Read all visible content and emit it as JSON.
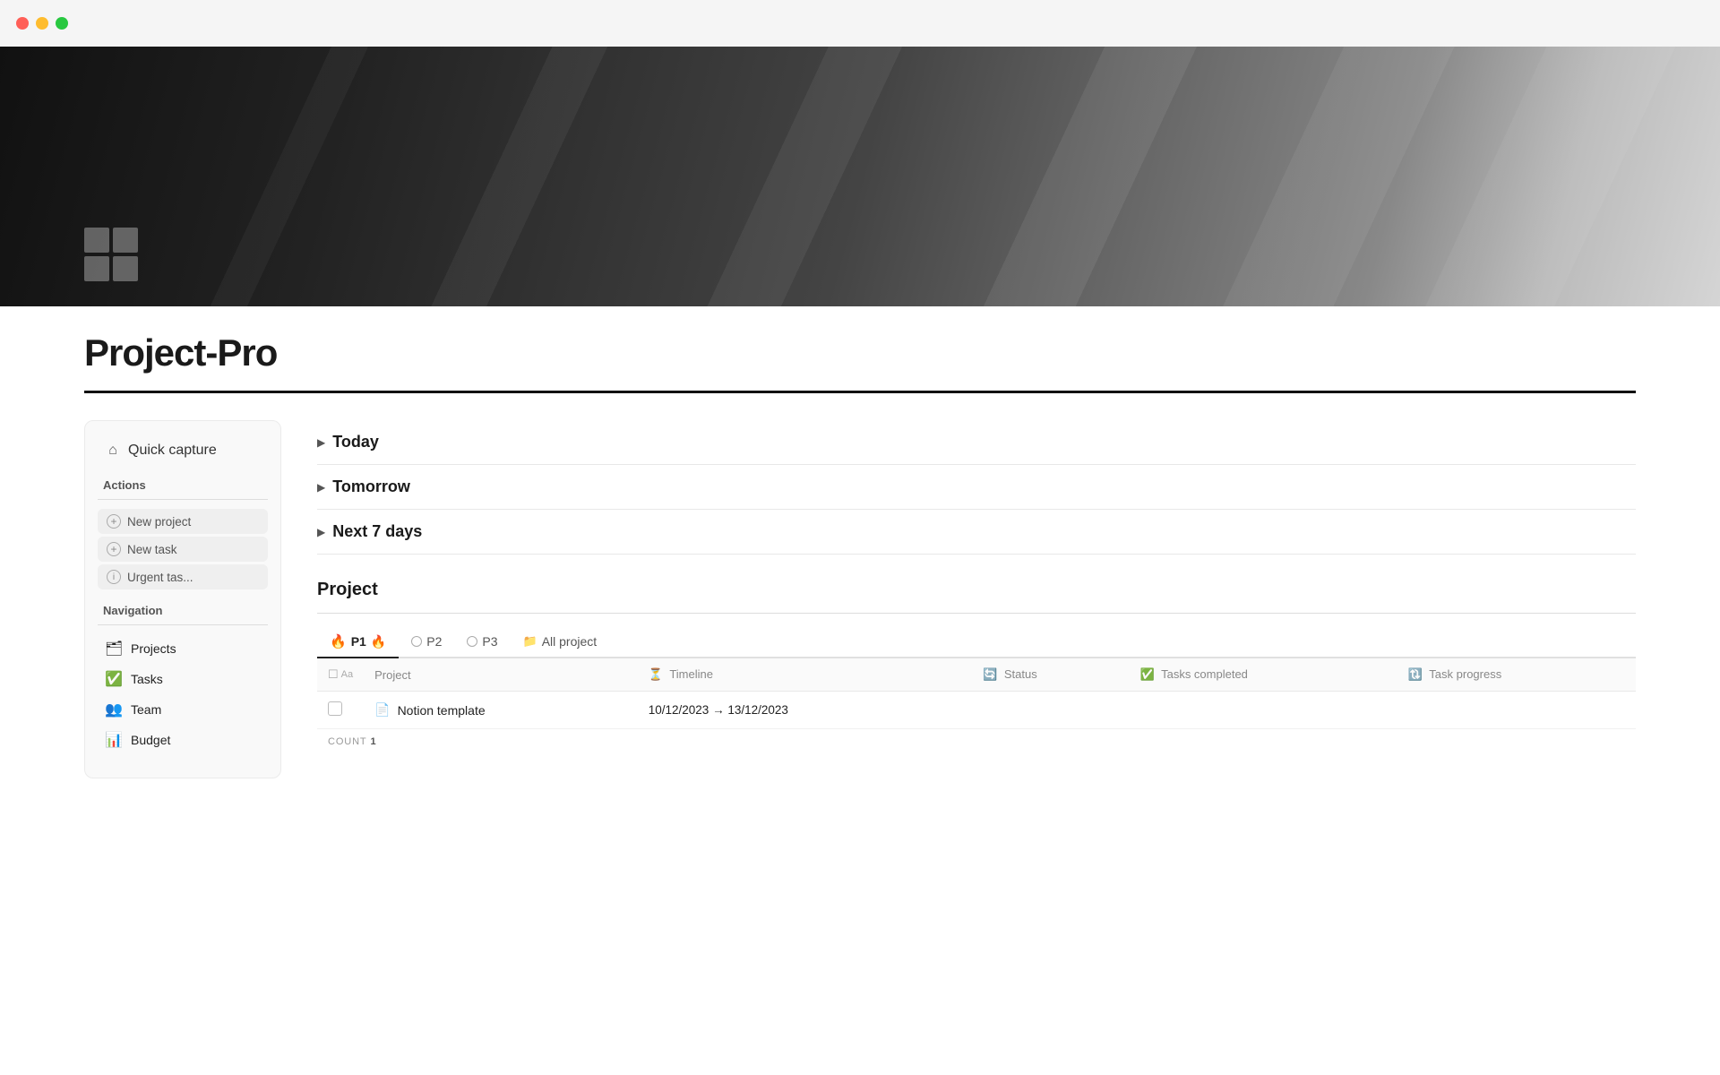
{
  "titlebar": {
    "traffic_lights": [
      "red",
      "yellow",
      "green"
    ]
  },
  "hero": {
    "icon_squares": 4
  },
  "page": {
    "title": "Project-Pro"
  },
  "sidebar": {
    "quick_capture_label": "Quick capture",
    "actions_label": "Actions",
    "nav_label": "Navigation",
    "action_buttons": [
      {
        "id": "new-project",
        "label": "New project",
        "icon": "+"
      },
      {
        "id": "new-task",
        "label": "New task",
        "icon": "+"
      },
      {
        "id": "urgent-task",
        "label": "Urgent tas...",
        "icon": "i"
      }
    ],
    "nav_items": [
      {
        "id": "projects",
        "label": "Projects",
        "icon": "🗂"
      },
      {
        "id": "tasks",
        "label": "Tasks",
        "icon": "✅"
      },
      {
        "id": "team",
        "label": "Team",
        "icon": "👥"
      },
      {
        "id": "budget",
        "label": "Budget",
        "icon": "📊"
      }
    ]
  },
  "content": {
    "sections": [
      {
        "id": "today",
        "label": "Today"
      },
      {
        "id": "tomorrow",
        "label": "Tomorrow"
      },
      {
        "id": "next7days",
        "label": "Next 7 days"
      }
    ],
    "project_section": {
      "heading": "Project",
      "tabs": [
        {
          "id": "p1",
          "label": "P1",
          "icon": "fire",
          "active": true
        },
        {
          "id": "p2",
          "label": "P2",
          "icon": "circle"
        },
        {
          "id": "p3",
          "label": "P3",
          "icon": "circle"
        },
        {
          "id": "all",
          "label": "All project",
          "icon": "folder"
        }
      ],
      "table": {
        "headers": [
          {
            "id": "check",
            "label": ""
          },
          {
            "id": "project",
            "label": "Project"
          },
          {
            "id": "timeline",
            "label": "Timeline"
          },
          {
            "id": "status",
            "label": "Status"
          },
          {
            "id": "tasks-completed",
            "label": "Tasks completed"
          },
          {
            "id": "task-progress",
            "label": "Task progress"
          }
        ],
        "rows": [
          {
            "id": "row-1",
            "name": "Notion template",
            "timeline_start": "10/12/2023",
            "timeline_end": "13/12/2023",
            "status": "",
            "tasks_completed": "",
            "task_progress": ""
          }
        ],
        "count_label": "COUNT",
        "count_value": "1"
      }
    }
  }
}
